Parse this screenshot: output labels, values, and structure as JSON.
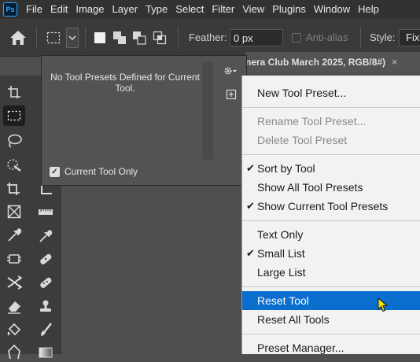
{
  "app": {
    "logo": "Ps"
  },
  "menubar": {
    "items": [
      "File",
      "Edit",
      "Image",
      "Layer",
      "Type",
      "Select",
      "Filter",
      "View",
      "Plugins",
      "Window",
      "Help"
    ]
  },
  "options": {
    "feather_label": "Feather:",
    "feather_value": "0 px",
    "antialias_label": "Anti-alias",
    "style_label": "Style:",
    "style_value": "Fixe"
  },
  "document_tab": {
    "title": "nera Club March 2025, RGB/8#)",
    "close": "×"
  },
  "preset_panel": {
    "empty_message": "No Tool Presets Defined for Current Tool.",
    "current_tool_only_label": "Current Tool Only",
    "current_tool_only_checked": true
  },
  "menu": {
    "items": [
      {
        "label": "New Tool Preset...",
        "checked": false,
        "disabled": false,
        "highlighted": false
      },
      {
        "label": "Rename Tool Preset...",
        "checked": false,
        "disabled": true,
        "highlighted": false
      },
      {
        "label": "Delete Tool Preset",
        "checked": false,
        "disabled": true,
        "highlighted": false
      },
      {
        "label": "Sort by Tool",
        "checked": true,
        "disabled": false,
        "highlighted": false
      },
      {
        "label": "Show All Tool Presets",
        "checked": false,
        "disabled": false,
        "highlighted": false
      },
      {
        "label": "Show Current Tool Presets",
        "checked": true,
        "disabled": false,
        "highlighted": false
      },
      {
        "label": "Text Only",
        "checked": false,
        "disabled": false,
        "highlighted": false
      },
      {
        "label": "Small List",
        "checked": true,
        "disabled": false,
        "highlighted": false
      },
      {
        "label": "Large List",
        "checked": false,
        "disabled": false,
        "highlighted": false
      },
      {
        "label": "Reset Tool",
        "checked": false,
        "disabled": false,
        "highlighted": true
      },
      {
        "label": "Reset All Tools",
        "checked": false,
        "disabled": false,
        "highlighted": false
      },
      {
        "label": "Preset Manager...",
        "checked": false,
        "disabled": false,
        "highlighted": false
      }
    ],
    "checkmark": "✔"
  },
  "colors": {
    "highlight": "#0a6ecf",
    "menu_bg": "#f2f2f2",
    "ui_dark": "#323232",
    "canvas": "#4f4f4f"
  }
}
